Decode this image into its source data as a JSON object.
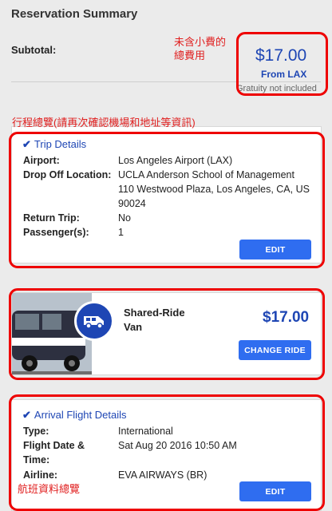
{
  "header": {
    "title": "Reservation Summary",
    "subtotal_label": "Subtotal:",
    "subtotal_amount": "$17.00",
    "from_label": "From LAX",
    "gratuity_note": "Gratuity not included"
  },
  "annotations": {
    "price_note_line1": "未含小費的",
    "price_note_line2": "總費用",
    "trip_note": "行程總覽(請再次確認機場和地址等資訊)",
    "flight_note": "航班資料總覽"
  },
  "trip": {
    "heading": "Trip Details",
    "airport_label": "Airport:",
    "airport_value": "Los Angeles Airport (LAX)",
    "dropoff_label": "Drop Off Location:",
    "dropoff_line1": "UCLA Anderson School of Management",
    "dropoff_line2": "110 Westwood Plaza, Los Angeles, CA, US",
    "dropoff_line3": "90024",
    "return_label": "Return Trip:",
    "return_value": "No",
    "passengers_label": "Passenger(s):",
    "passengers_value": "1",
    "edit_label": "EDIT"
  },
  "ride": {
    "name_line1": "Shared-Ride",
    "name_line2": "Van",
    "price": "$17.00",
    "change_label": "CHANGE RIDE"
  },
  "flight": {
    "heading": "Arrival Flight Details",
    "type_label": "Type:",
    "type_value": "International",
    "date_label_line1": "Flight Date &",
    "date_label_line2": "Time:",
    "date_value": "Sat Aug 20 2016 10:50 AM",
    "airline_label": "Airline:",
    "airline_value": "EVA AIRWAYS (BR)",
    "edit_label": "EDIT"
  },
  "colors": {
    "accent": "#1e46b4",
    "button": "#2f6df0",
    "annotation": "#e01e1e"
  }
}
